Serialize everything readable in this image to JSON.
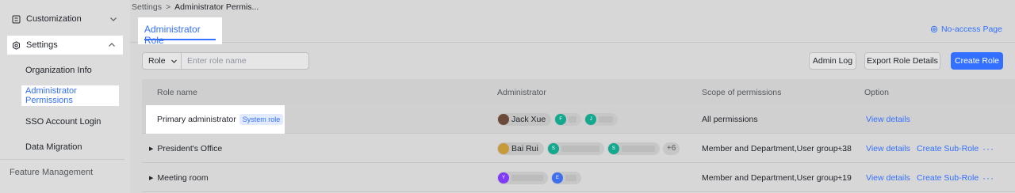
{
  "sidebar": {
    "groups": [
      {
        "label": "Customization",
        "icon": "customization-icon",
        "chevron": "chevron-down-icon"
      },
      {
        "label": "Settings",
        "icon": "settings-gear-icon",
        "chevron": "chevron-up-icon"
      }
    ],
    "sub_items": [
      {
        "label": "Organization Info"
      },
      {
        "label": "Administrator Permissions"
      },
      {
        "label": "SSO Account Login"
      },
      {
        "label": "Data Migration"
      }
    ],
    "feature_management": "Feature Management"
  },
  "breadcrumb": {
    "root": "Settings",
    "separator": ">",
    "current": "Administrator Permis..."
  },
  "tabs": {
    "active": "Administrator Role"
  },
  "no_access_link": "No-access Page",
  "filter": {
    "select_label": "Role",
    "placeholder": "Enter role name"
  },
  "buttons": {
    "admin_log": "Admin Log",
    "export": "Export Role Details",
    "create": "Create Role"
  },
  "table": {
    "headers": {
      "role_name": "Role name",
      "administrator": "Administrator",
      "scope": "Scope of permissions",
      "option": "Option"
    },
    "rows": [
      {
        "name": "Primary administrator",
        "badge": "System role",
        "admin_named": "Jack Xue",
        "admin_chips": [
          "F",
          "J"
        ],
        "more": "",
        "scope": "All permissions",
        "scope_count": "",
        "view": "View details",
        "sub": ""
      },
      {
        "name": "President's Office",
        "badge": "",
        "admin_named": "Bai Rui",
        "admin_chips": [
          "S",
          "S"
        ],
        "more": "+6",
        "scope": "Member and Department,User group ...",
        "scope_count": "+38",
        "view": "View details",
        "sub": "Create Sub-Role"
      },
      {
        "name": "Meeting room",
        "badge": "",
        "admin_named": "",
        "admin_chips": [
          "Y",
          "E"
        ],
        "more": "",
        "scope": "Member and Department,User group ...",
        "scope_count": "+19",
        "view": "View details",
        "sub": "Create Sub-Role"
      }
    ]
  },
  "colors": {
    "accent": "#3370ff",
    "avatar_teal": "#14a88f",
    "avatar_purple": "#7f3bf5",
    "avatar_blue": "#3e6ff0"
  }
}
